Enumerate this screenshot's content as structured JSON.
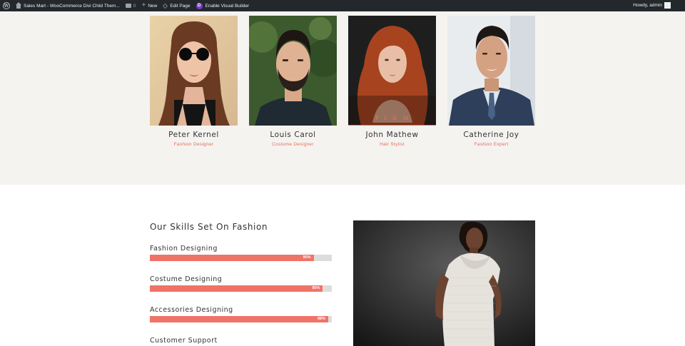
{
  "admin_bar": {
    "site_name": "Sales Mart - WooCommerce Divi Child Them...",
    "comments_count": "0",
    "new_label": "New",
    "edit_page_label": "Edit Page",
    "visual_builder_label": "Enable Visual Builder",
    "howdy": "Howdy, admin"
  },
  "team": {
    "members": [
      {
        "name": "Peter Kernel",
        "role": "Fashion Designer"
      },
      {
        "name": "Louis Carol",
        "role": "Costume Designer"
      },
      {
        "name": "John Mathew",
        "role": "Hair Stylist",
        "socials": [
          "f",
          "t",
          "G",
          "in"
        ]
      },
      {
        "name": "Catherine Joy",
        "role": "Fashion Expert"
      }
    ]
  },
  "skills": {
    "title": "Our Skills Set On Fashion",
    "items": [
      {
        "label": "Fashion Designing",
        "percent_text": "90%",
        "percent": 90
      },
      {
        "label": "Costume Designing",
        "percent_text": "95%",
        "percent": 95
      },
      {
        "label": "Accessories Designing",
        "percent_text": "98%",
        "percent": 98
      },
      {
        "label": "Customer Support"
      }
    ]
  },
  "colors": {
    "accent": "#e8685c",
    "bar_fill": "#f07367",
    "bar_track": "#dddddd",
    "team_bg": "#f5f3f0",
    "admin_bar_bg": "#23282d"
  }
}
